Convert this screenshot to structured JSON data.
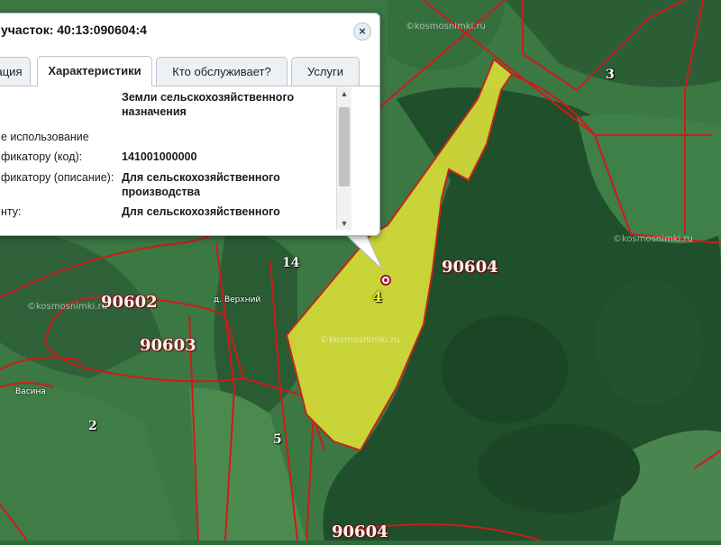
{
  "popup": {
    "title": "участок: 40:13:090604:4",
    "close_label": "×",
    "tabs": [
      {
        "label": "ация",
        "active": false
      },
      {
        "label": "Характеристики",
        "active": true
      },
      {
        "label": "Кто обслуживает?",
        "active": false
      },
      {
        "label": "Услуги",
        "active": false
      }
    ],
    "rows": [
      {
        "label": "",
        "value_lines": [
          "Земли сельскохозяйственного",
          "назначения"
        ]
      },
      {
        "label": "е использование",
        "value_lines": []
      },
      {
        "label": "фикатору (код):",
        "value_lines": [
          "141001000000"
        ]
      },
      {
        "label": "фикатору (описание):",
        "value_lines": [
          "Для сельскохозяйственного",
          "производства"
        ]
      },
      {
        "label": "нту:",
        "value_lines": [
          "Для сельскохозяйственного"
        ]
      }
    ]
  },
  "map": {
    "quarter_labels": [
      "90602",
      "90603",
      "90604",
      "90604"
    ],
    "plot_labels": [
      "3",
      "14",
      "4",
      "2",
      "5"
    ],
    "selected_plot": "4",
    "place_names": [
      "д. Верхний",
      "Васина"
    ],
    "watermarks": [
      "©kosmosnimki.ru",
      "©kosmosnimki.ru",
      "©kosmosnimki.ru",
      "©kosmosnimki.ru"
    ],
    "colors": {
      "boundary": "#d01a1a",
      "selected_fill": "#d6dc38",
      "selected_outline": "#c0281a",
      "forest": "#1f4e2b",
      "field": "#3a7a44"
    }
  }
}
